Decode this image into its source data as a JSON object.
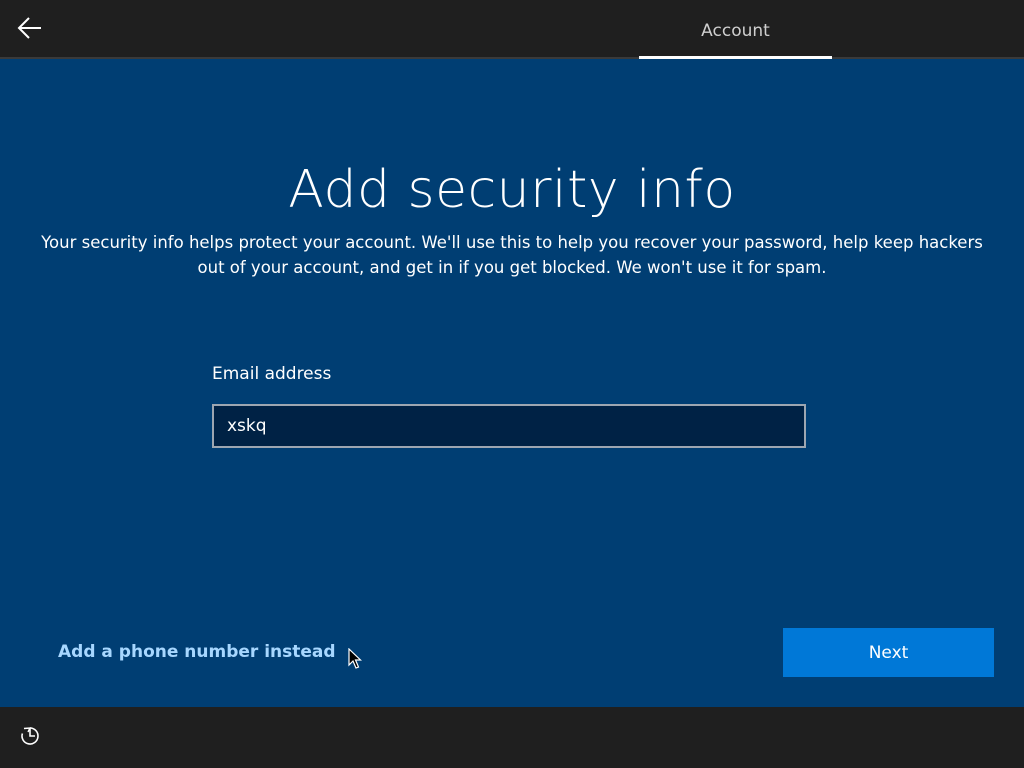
{
  "header": {
    "back_icon": "arrow-left-icon",
    "tab_label": "Account"
  },
  "main": {
    "title": "Add security info",
    "description": "Your security info helps protect your account. We'll use this to help you recover your password, help keep hackers out of your account, and get in if you get blocked. We won't use it for spam.",
    "email_label": "Email address",
    "email_value": "xskq",
    "alternate_link": "Add a phone number instead",
    "next_label": "Next"
  },
  "footer": {
    "ease_of_access_icon": "ease-of-access-icon"
  },
  "colors": {
    "background": "#003e73",
    "bar": "#1f1f1f",
    "accent": "#0078d7",
    "link": "#a7d7ff",
    "input_background": "#002245"
  }
}
